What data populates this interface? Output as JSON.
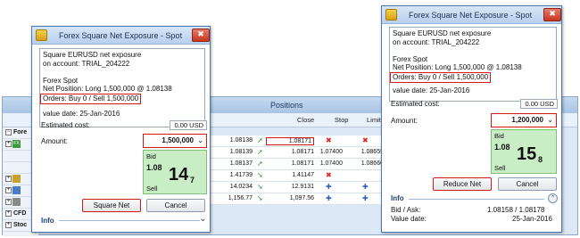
{
  "positions_window": {
    "title": "Positions",
    "columns": [
      "Close",
      "Stop",
      "Limit"
    ],
    "sidebar_rows": [
      "Fore",
      "",
      "",
      "",
      "",
      "",
      "",
      "CFD",
      "Stoc"
    ],
    "rows": [
      {
        "open": "1.08138",
        "close": "1.08171",
        "stop": "",
        "limit": ""
      },
      {
        "open": "1.08139",
        "close": "1.08171",
        "stop": "1.07400",
        "limit": "1.08655"
      },
      {
        "open": "1.08137",
        "close": "1.08171",
        "stop": "1.07400",
        "limit": "1.08660"
      },
      {
        "open": "1.41739",
        "close": "1.41147",
        "stop": "",
        "limit": ""
      },
      {
        "open": "14.0234",
        "close": "12.9131",
        "stop": "",
        "limit": ""
      },
      {
        "open": "1,156.77",
        "close": "1,097.56",
        "stop": "",
        "limit": ""
      }
    ]
  },
  "dialog_left": {
    "title": "Forex Square Net Exposure - Spot",
    "info_lines": [
      "Square EURUSD net exposure",
      "on account: TRIAL_204222",
      "",
      "Forex Spot",
      "Net Position: Long 1,500,000 @ 1.08138"
    ],
    "orders": "Orders: Buy 0 / Sell 1,500,000",
    "value_date": "value date: 25-Jan-2016",
    "estimated_cost_label": "Estimated cost:",
    "estimated_cost_value": "0.00 USD",
    "amount_label": "Amount:",
    "amount_value": "1,500,000",
    "quote": {
      "label": "Bid",
      "big": "1.08",
      "pips": "14",
      "tenth": "7",
      "side": "Sell"
    },
    "primary_button": "Square Net",
    "cancel_button": "Cancel",
    "info_header": "Info"
  },
  "dialog_right": {
    "title": "Forex Square Net Exposure - Spot",
    "info_lines": [
      "Square EURUSD net exposure",
      "on account: TRIAL_204222",
      "",
      "Forex Spot",
      "Net Position: Long 1,500,000 @ 1.08138"
    ],
    "orders": "Orders: Buy 0 / Sell 1,500,000",
    "value_date": "value date: 25-Jan-2016",
    "estimated_cost_label": "Estimated cost:",
    "estimated_cost_value": "0.00 USD",
    "amount_label": "Amount:",
    "amount_value": "1,200,000",
    "quote": {
      "label": "Bid",
      "big": "1.08",
      "pips": "15",
      "tenth": "8",
      "side": "Sell"
    },
    "primary_button": "Reduce Net",
    "cancel_button": "Cancel",
    "info_header": "Info",
    "bid_ask_label": "Bid / Ask:",
    "bid_ask_value": "1.08158 / 1.08178",
    "value_date_label": "Value date:",
    "value_date_value": "25-Jan-2016"
  },
  "close_glyph": "✖",
  "dropdown_glyph": "⌄"
}
